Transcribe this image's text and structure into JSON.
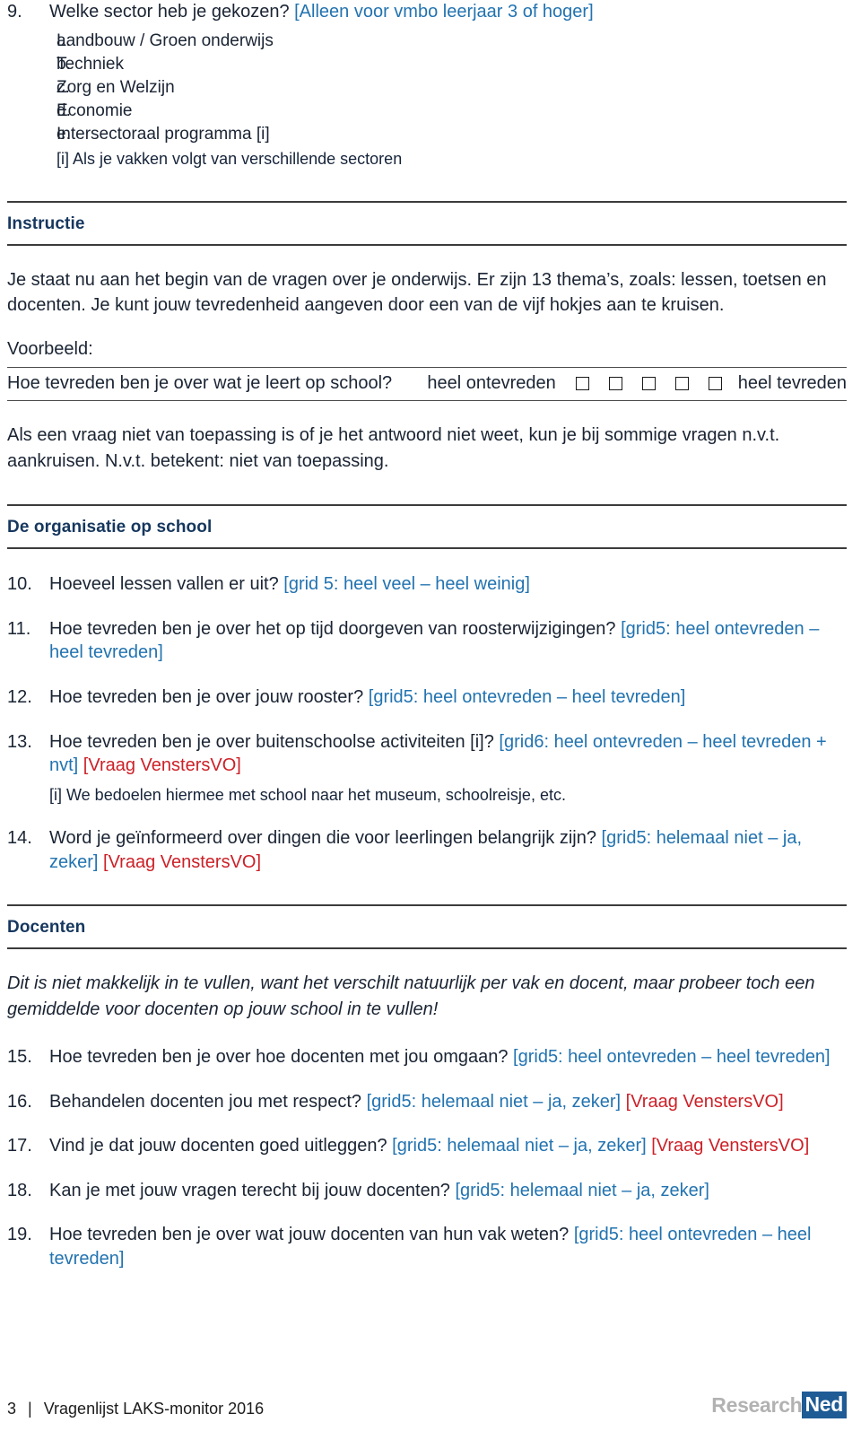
{
  "question9": {
    "number": "9.",
    "text": "Welke sector heb je gekozen? ",
    "tag": "[Alleen voor vmbo leerjaar 3 of hoger]",
    "options": [
      {
        "letter": "a.",
        "label": "Landbouw / Groen onderwijs"
      },
      {
        "letter": "b.",
        "label": "Techniek"
      },
      {
        "letter": "c.",
        "label": "Zorg en Welzijn"
      },
      {
        "letter": "d.",
        "label": "Economie"
      },
      {
        "letter": "e.",
        "label": "Intersectoraal programma [i]"
      }
    ],
    "footnote": "[i] Als je vakken volgt van verschillende sectoren"
  },
  "instructie": {
    "heading": "Instructie",
    "paragraph": "Je staat nu aan het begin van de vragen over je onderwijs. Er zijn 13 thema’s, zoals: lessen, toetsen en docenten. Je kunt jouw tevredenheid aangeven door een van de vijf hokjes aan te kruisen.",
    "voorbeeld_label": "Voorbeeld:",
    "example": {
      "question": "Hoe tevreden ben je over wat je leert op school?",
      "left_label": "heel ontevreden",
      "right_label": "heel tevreden",
      "checkbox_count": 5
    },
    "nvt_paragraph": "Als een vraag niet van toepassing is of je het antwoord niet weet, kun je bij sommige vragen n.v.t. aankruisen. N.v.t. betekent: niet van toepassing."
  },
  "organisatie": {
    "heading": "De organisatie op school",
    "questions": [
      {
        "number": "10.",
        "text": "Hoeveel lessen vallen er uit? ",
        "grid": "[grid 5: heel veel – heel weinig]",
        "vensters": "",
        "sub": ""
      },
      {
        "number": "11.",
        "text": "Hoe tevreden ben je over het op tijd doorgeven van roosterwijzigingen? ",
        "grid": "[grid5: heel ontevreden – heel tevreden]",
        "vensters": "",
        "sub": ""
      },
      {
        "number": "12.",
        "text": "Hoe tevreden ben je over jouw rooster? ",
        "grid": "[grid5: heel ontevreden – heel tevreden]",
        "vensters": "",
        "sub": ""
      },
      {
        "number": "13.",
        "text": "Hoe tevreden ben je over buitenschoolse activiteiten [i]? ",
        "grid": "[grid6: heel ontevreden – heel tevreden + nvt]",
        "vensters": " [Vraag VenstersVO]",
        "sub": "[i] We bedoelen hiermee met school naar het museum, schoolreisje, etc."
      },
      {
        "number": "14.",
        "text": "Word je geïnformeerd over dingen die voor leerlingen belangrijk zijn? ",
        "grid": "[grid5: helemaal niet – ja, zeker]",
        "vensters": " [Vraag VenstersVO]",
        "sub": ""
      }
    ]
  },
  "docenten": {
    "heading": "Docenten",
    "intro": "Dit is niet makkelijk in te vullen, want het verschilt natuurlijk per vak en docent, maar probeer toch een gemiddelde voor docenten op jouw school in te vullen!",
    "questions": [
      {
        "number": "15.",
        "text": "Hoe tevreden ben je over hoe docenten met jou omgaan? ",
        "grid": "[grid5: heel ontevreden – heel tevreden]",
        "vensters": "",
        "sub": ""
      },
      {
        "number": "16.",
        "text": "Behandelen docenten jou met respect? ",
        "grid": "[grid5: helemaal niet – ja, zeker]",
        "vensters": " [Vraag VenstersVO]",
        "sub": ""
      },
      {
        "number": "17.",
        "text": "Vind je dat jouw docenten goed uitleggen? ",
        "grid": "[grid5: helemaal niet – ja, zeker]",
        "vensters": " [Vraag VenstersVO]",
        "sub": ""
      },
      {
        "number": "18.",
        "text": "Kan je met jouw vragen terecht bij jouw docenten? ",
        "grid": "[grid5: helemaal niet – ja, zeker]",
        "vensters": "",
        "sub": ""
      },
      {
        "number": "19.",
        "text": "Hoe tevreden ben je over wat jouw docenten van hun vak weten? ",
        "grid": "[grid5: heel ontevreden – heel tevreden]",
        "vensters": "",
        "sub": ""
      }
    ]
  },
  "footer": {
    "page": "3",
    "separator": "|",
    "title": "Vragenlijst LAKS-monitor 2016",
    "logo_part1": "Research",
    "logo_part2": "Ned"
  },
  "colors": {
    "blue": "#2273b0",
    "red": "#cc2027",
    "navy": "#16375e",
    "logo_blue": "#1f5b94",
    "logo_gray": "#b2b2b2"
  }
}
